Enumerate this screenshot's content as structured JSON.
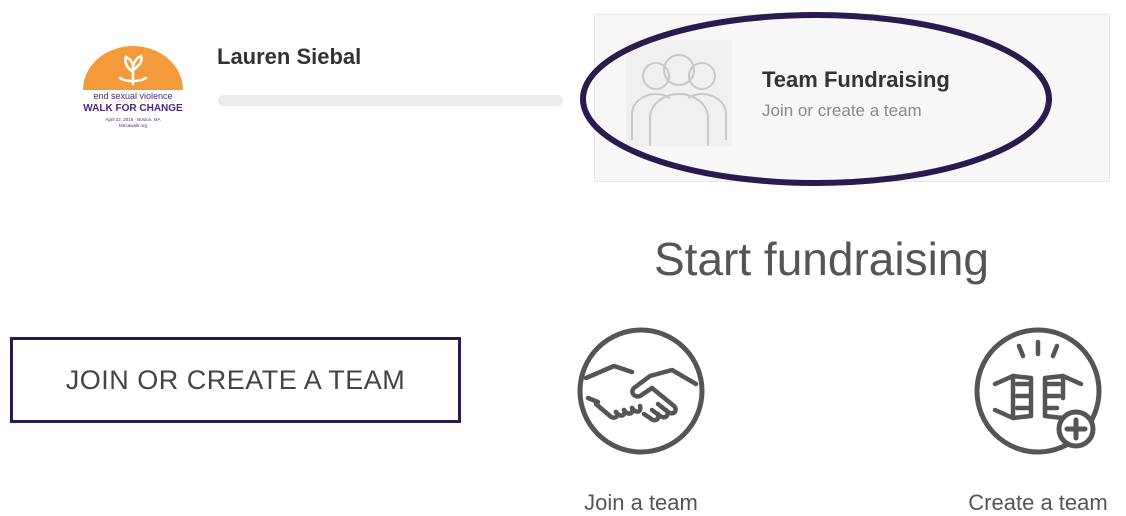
{
  "user": {
    "name": "Lauren Siebal",
    "fundraising_progress": 0
  },
  "event_logo": {
    "line1": "end sexual violence",
    "line2": "WALK FOR CHANGE",
    "line3": "April 22, 2018 · Boston, MA",
    "line4": "barcawalk.org"
  },
  "team_card": {
    "title": "Team Fundraising",
    "subtitle": "Join or create a team",
    "icon": "team-silhouette-icon"
  },
  "section": {
    "title": "Start fundraising"
  },
  "actions": {
    "join_or_create_label": "JOIN OR CREATE A TEAM",
    "join_team_label": "Join a team",
    "create_team_label": "Create a team",
    "join_team_icon": "handshake-icon",
    "create_team_icon": "fist-bump-plus-icon"
  },
  "colors": {
    "accent_purple": "#2b1a4d",
    "logo_orange": "#f39a3c",
    "logo_purple": "#4b2a7a",
    "icon_gray": "#555555"
  }
}
